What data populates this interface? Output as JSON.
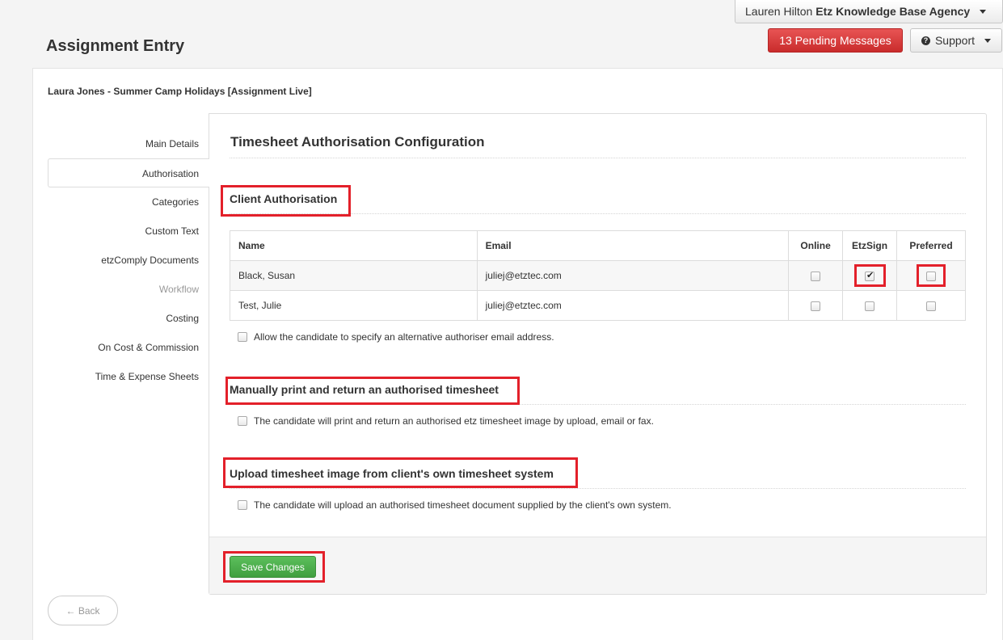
{
  "header": {
    "user_name": "Lauren Hilton",
    "agency_name": "Etz Knowledge Base Agency",
    "pending_messages": "13 Pending Messages",
    "support_label": "Support",
    "page_title": "Assignment Entry"
  },
  "assignment": {
    "summary": "Laura Jones - Summer Camp Holidays [Assignment Live]"
  },
  "nav": {
    "items": [
      {
        "label": "Main Details"
      },
      {
        "label": "Authorisation"
      },
      {
        "label": "Categories"
      },
      {
        "label": "Custom Text"
      },
      {
        "label": "etzComply Documents"
      },
      {
        "label": "Workflow"
      },
      {
        "label": "Costing"
      },
      {
        "label": "On Cost & Commission"
      },
      {
        "label": "Time & Expense Sheets"
      }
    ],
    "active_index": 1,
    "disabled_index": 5
  },
  "content": {
    "title": "Timesheet Authorisation Configuration",
    "client_auth": {
      "heading": "Client Authorisation",
      "columns": [
        "Name",
        "Email",
        "Online",
        "EtzSign",
        "Preferred"
      ],
      "rows": [
        {
          "name": "Black, Susan",
          "email": "juliej@etztec.com",
          "online": false,
          "etzsign": true,
          "preferred": false
        },
        {
          "name": "Test, Julie",
          "email": "juliej@etztec.com",
          "online": false,
          "etzsign": false,
          "preferred": false
        }
      ],
      "alt_email_label": "Allow the candidate to specify an alternative authoriser email address."
    },
    "manual": {
      "heading": "Manually print and return an authorised timesheet",
      "option_label": "The candidate will print and return an authorised etz timesheet image by upload, email or fax."
    },
    "upload": {
      "heading": "Upload timesheet image from client's own timesheet system",
      "option_label": "The candidate will upload an authorised timesheet document supplied by the client's own system."
    },
    "save_label": "Save Changes"
  },
  "footer": {
    "back_label": "← Back"
  },
  "colors": {
    "danger": "#d9343a",
    "success": "#47a447",
    "highlight": "#e3202a"
  }
}
